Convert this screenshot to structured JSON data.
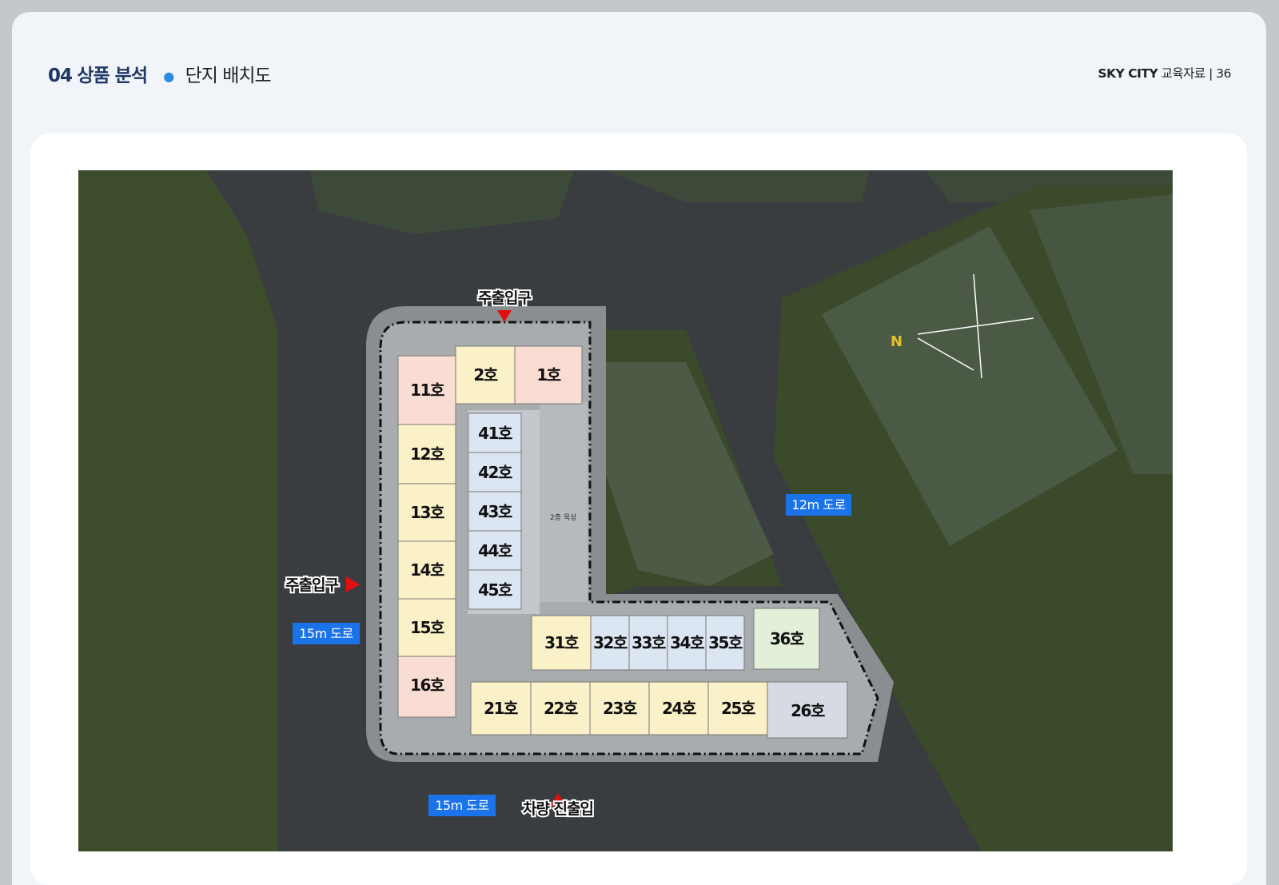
{
  "header": {
    "section_number": "04",
    "section_title": "상품 분석",
    "page_title": "단지 배치도",
    "brand": "SKY CITY",
    "doc_type": "교육자료",
    "separator": "|",
    "page_number": "36"
  },
  "roads": {
    "road_12m": "12m 도로",
    "road_15m_west": "15m 도로",
    "road_15m_south": "15m 도로"
  },
  "entrances": {
    "main_north": "주출입구",
    "main_west": "주출입구",
    "vehicle": "차량 진출입"
  },
  "units": {
    "u1": "1호",
    "u2": "2호",
    "u11": "11호",
    "u12": "12호",
    "u13": "13호",
    "u14": "14호",
    "u15": "15호",
    "u16": "16호",
    "u21": "21호",
    "u22": "22호",
    "u23": "23호",
    "u24": "24호",
    "u25": "25호",
    "u26": "26호",
    "u31": "31호",
    "u32": "32호",
    "u33": "33호",
    "u34": "34호",
    "u35": "35호",
    "u36": "36호",
    "u41": "41호",
    "u42": "42호",
    "u43": "43호",
    "u44": "44호",
    "u45": "45호"
  },
  "colors": {
    "pink": "#f9ddd2",
    "yellow": "#fbf1c9",
    "blue": "#dce6f3",
    "gray": "#d6dbe3",
    "green": "#e2efd9",
    "road_tag": "#1a73e8",
    "arrow": "#e01010"
  }
}
